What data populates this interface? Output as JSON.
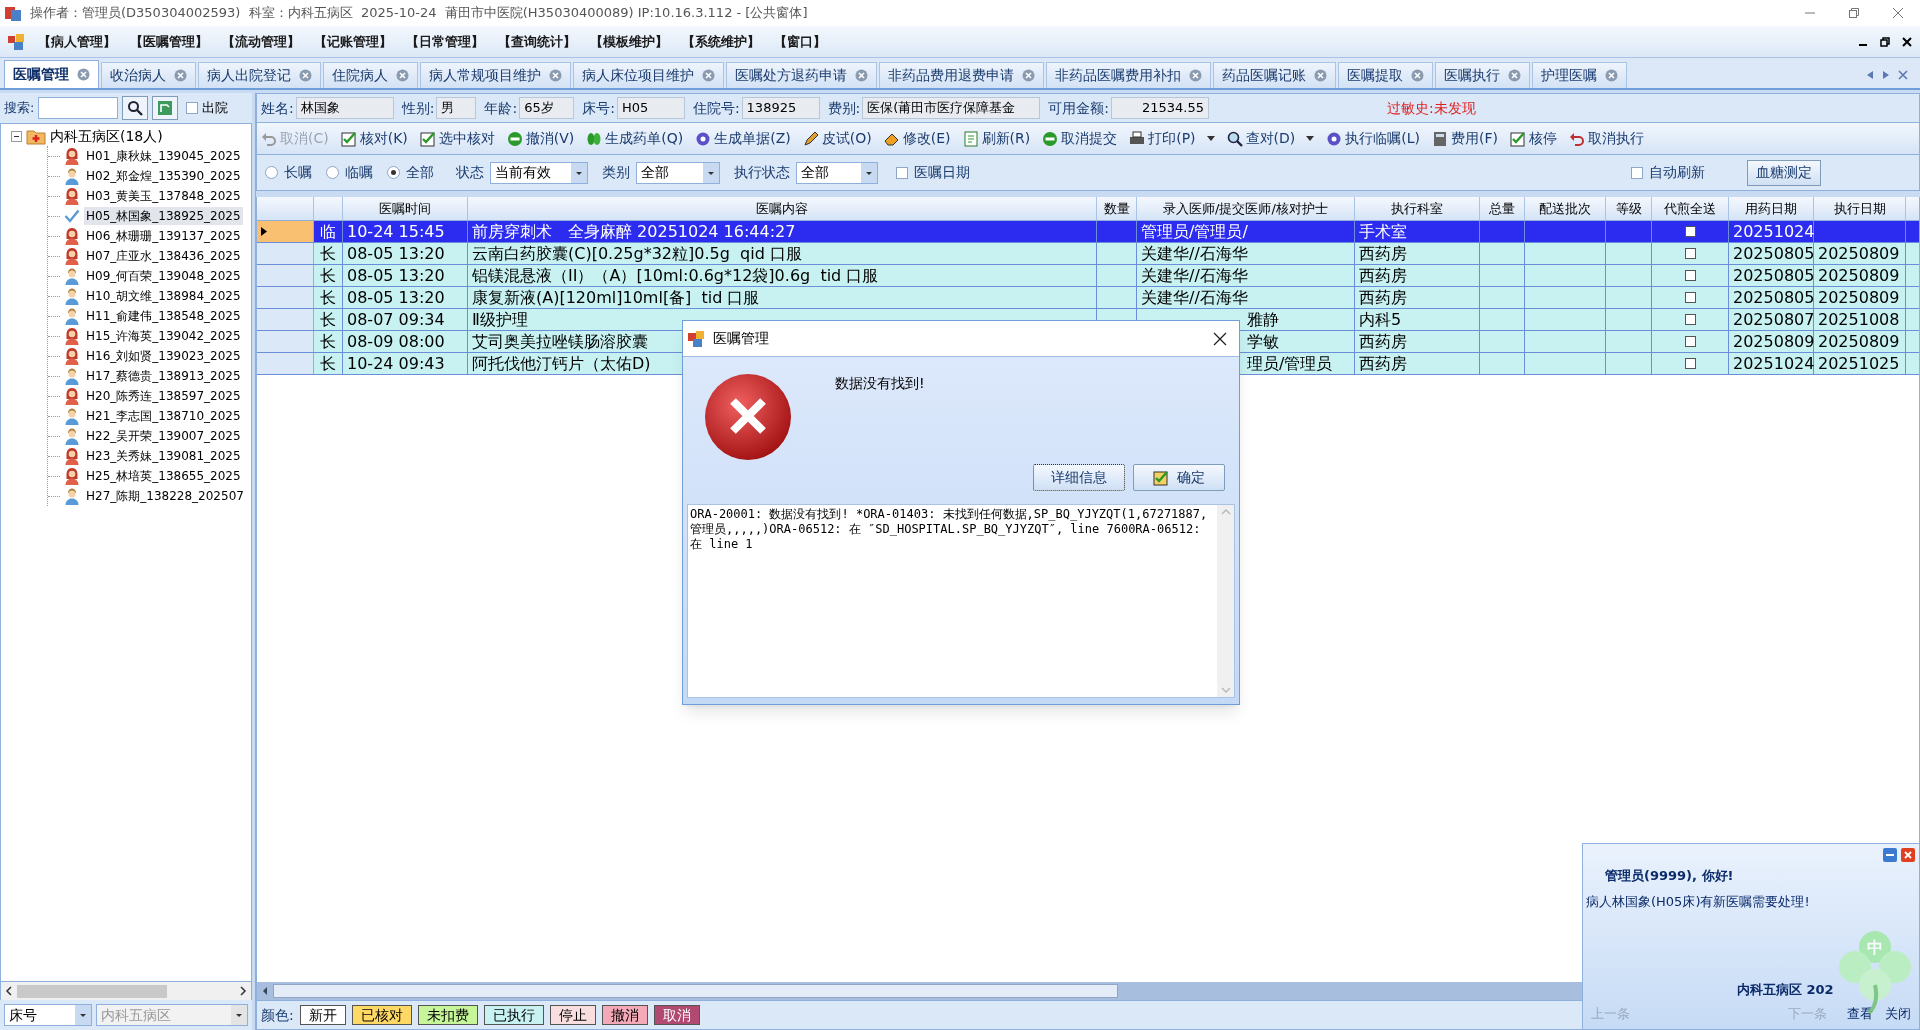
{
  "title_bar": {
    "title": "操作者：管理员(D350304002593)  科室：内科五病区  2025-10-24  莆田市中医院(H35030400089) IP:10.16.3.112 - [公共窗体]"
  },
  "menu": [
    "【病人管理】",
    "【医嘱管理】",
    "【流动管理】",
    "【记账管理】",
    "【日常管理】",
    "【查询统计】",
    "【模板维护】",
    "【系统维护】",
    "【窗口】"
  ],
  "tabs": [
    {
      "label": "医嘱管理",
      "selected": true
    },
    {
      "label": "收治病人",
      "selected": false
    },
    {
      "label": "病人出院登记",
      "selected": false
    },
    {
      "label": "住院病人",
      "selected": false
    },
    {
      "label": "病人常规项目维护",
      "selected": false
    },
    {
      "label": "病人床位项目维护",
      "selected": false
    },
    {
      "label": "医嘱处方退药申请",
      "selected": false
    },
    {
      "label": "非药品费用退费申请",
      "selected": false
    },
    {
      "label": "非药品医嘱费用补扣",
      "selected": false
    },
    {
      "label": "药品医嘱记账",
      "selected": false
    },
    {
      "label": "医嘱提取",
      "selected": false
    },
    {
      "label": "医嘱执行",
      "selected": false
    },
    {
      "label": "护理医嘱",
      "selected": false
    }
  ],
  "search": {
    "label": "搜索:",
    "discharged": {
      "label": "出院",
      "checked": false
    }
  },
  "tree": {
    "label": "内科五病区(18人)",
    "expanded": true,
    "children": [
      {
        "label": "H01_康秋妹_139045_2025",
        "kind": "female",
        "selected": false
      },
      {
        "label": "H02_郑金煌_135390_2025",
        "kind": "male",
        "selected": false
      },
      {
        "label": "H03_黄美玉_137848_2025",
        "kind": "female",
        "selected": false
      },
      {
        "label": "H05_林国象_138925_2025",
        "kind": "current",
        "selected": true
      },
      {
        "label": "H06_林珊珊_139137_2025",
        "kind": "female",
        "selected": false
      },
      {
        "label": "H07_庄亚水_138436_2025",
        "kind": "female",
        "selected": false
      },
      {
        "label": "H09_何百荣_139048_2025",
        "kind": "male",
        "selected": false
      },
      {
        "label": "H10_胡文维_138984_2025",
        "kind": "male",
        "selected": false
      },
      {
        "label": "H11_俞建伟_138548_2025",
        "kind": "male",
        "selected": false
      },
      {
        "label": "H15_许海英_139042_2025",
        "kind": "female",
        "selected": false
      },
      {
        "label": "H16_刘如贤_139023_2025",
        "kind": "female",
        "selected": false
      },
      {
        "label": "H17_蔡德贵_138913_2025",
        "kind": "male",
        "selected": false
      },
      {
        "label": "H20_陈秀连_138597_2025",
        "kind": "female",
        "selected": false
      },
      {
        "label": "H21_李志国_138710_2025",
        "kind": "male",
        "selected": false
      },
      {
        "label": "H22_吴开荣_139007_2025",
        "kind": "male",
        "selected": false
      },
      {
        "label": "H23_关秀妹_139081_2025",
        "kind": "female",
        "selected": false
      },
      {
        "label": "H25_林培英_138655_2025",
        "kind": "female",
        "selected": false
      },
      {
        "label": "H27_陈期_138228_202507",
        "kind": "male",
        "selected": false
      }
    ]
  },
  "bed_select": {
    "value": "床号"
  },
  "ward_select": {
    "value": "内科五病区",
    "disabled": true
  },
  "patient_info": [
    {
      "label": "姓名:",
      "value": "林国象"
    },
    {
      "label": "性别:",
      "value": "男"
    },
    {
      "label": "年龄:",
      "value": "65岁"
    },
    {
      "label": "床号:",
      "value": "H05"
    },
    {
      "label": "住院号:",
      "value": "138925"
    },
    {
      "label": "费别:",
      "value": "医保(莆田市医疗保障基金"
    },
    {
      "label": "可用金额:",
      "value": "21534.55"
    }
  ],
  "allergy": "过敏史:未发现",
  "toolbar": [
    {
      "label": "取消(C)",
      "disabled": true,
      "dropdown": false
    },
    {
      "label": "核对(K)",
      "disabled": false,
      "dropdown": false
    },
    {
      "label": "选中核对",
      "disabled": false,
      "dropdown": false
    },
    {
      "label": "撤消(V)",
      "disabled": false,
      "dropdown": false
    },
    {
      "label": "生成药单(Q)",
      "disabled": false,
      "dropdown": false
    },
    {
      "label": "生成单据(Z)",
      "disabled": false,
      "dropdown": false
    },
    {
      "label": "皮试(O)",
      "disabled": false,
      "dropdown": false
    },
    {
      "label": "修改(E)",
      "disabled": false,
      "dropdown": false
    },
    {
      "label": "刷新(R)",
      "disabled": false,
      "dropdown": false
    },
    {
      "label": "取消提交",
      "disabled": false,
      "dropdown": false
    },
    {
      "label": "打印(P)",
      "disabled": false,
      "dropdown": true
    },
    {
      "label": "查对(D)",
      "disabled": false,
      "dropdown": true
    },
    {
      "label": "执行临嘱(L)",
      "disabled": false,
      "dropdown": false
    },
    {
      "label": "费用(F)",
      "disabled": false,
      "dropdown": false
    },
    {
      "label": "核停",
      "disabled": false,
      "dropdown": false
    },
    {
      "label": "取消执行",
      "disabled": false,
      "dropdown": false
    }
  ],
  "filters": {
    "order_types": [
      {
        "label": "长嘱",
        "selected": false
      },
      {
        "label": "临嘱",
        "selected": false
      },
      {
        "label": "全部",
        "selected": true
      }
    ],
    "selects": [
      {
        "label": "状态",
        "value": "当前有效"
      },
      {
        "label": "类别",
        "value": "全部"
      },
      {
        "label": "执行状态",
        "value": "全部"
      }
    ],
    "order_date": {
      "label": "医嘱日期",
      "checked": false
    },
    "auto_refresh": {
      "label": "自动刷新",
      "checked": false
    },
    "glucose_button": "血糖测定"
  },
  "table": {
    "columns": [
      "医嘱时间",
      "医嘱内容",
      "数量",
      "录入医师/提交医师/核对护士",
      "执行科室",
      "总量",
      "配送批次",
      "等级",
      "代煎全送",
      "用药日期",
      "执行日期"
    ],
    "rows": [
      {
        "selected": true,
        "order_type": "临",
        "time": "10-24 15:45",
        "content": "前房穿刺术　全身麻醉 20251024 16:44:27",
        "doctor": "管理员/管理员/",
        "dept": "手术室",
        "full_send": false,
        "med_date": "20251024"
      },
      {
        "selected": false,
        "order_type": "长",
        "time": "08-05 13:20",
        "content": "云南白药胶囊(C)[0.25g*32粒]0.5g  qid 口服",
        "doctor": "关建华//石海华",
        "dept": "西药房",
        "full_send": false,
        "med_date": "20250805",
        "exec_date": "20250809"
      },
      {
        "selected": false,
        "order_type": "长",
        "time": "08-05 13:20",
        "content": "铝镁混悬液（II）（A）[10ml:0.6g*12袋]0.6g  tid 口服",
        "doctor": "关建华//石海华",
        "dept": "西药房",
        "full_send": false,
        "med_date": "20250805",
        "exec_date": "20250809"
      },
      {
        "selected": false,
        "order_type": "长",
        "time": "08-05 13:20",
        "content": "康复新液(A)[120ml]10ml[备]  tid 口服",
        "doctor": "关建华//石海华",
        "dept": "西药房",
        "full_send": false,
        "med_date": "20250805",
        "exec_date": "20250809"
      },
      {
        "selected": false,
        "order_type": "长",
        "time": "08-07 09:34",
        "content": "Ⅱ级护理",
        "doctor": "雅静",
        "dept": "内科5",
        "full_send": false,
        "med_date": "20250807",
        "exec_date": "20251008"
      },
      {
        "selected": false,
        "order_type": "长",
        "time": "08-09 08:00",
        "content": "艾司奥美拉唑镁肠溶胶囊",
        "doctor": "学敏",
        "dept": "西药房",
        "full_send": false,
        "med_date": "20250809",
        "exec_date": "20250809"
      },
      {
        "selected": false,
        "order_type": "长",
        "time": "10-24 09:43",
        "content": "阿托伐他汀钙片（太佑D)",
        "doctor": "理员/管理员",
        "dept": "西药房",
        "full_send": false,
        "med_date": "20251024",
        "exec_date": "20251025"
      }
    ]
  },
  "legend": {
    "label": "颜色:",
    "items": [
      {
        "label": "新开",
        "color": "#ffffff"
      },
      {
        "label": "已核对",
        "color": "#ffd966"
      },
      {
        "label": "未扣费",
        "color": "#c6f59a"
      },
      {
        "label": "已执行",
        "color": "#c8f2f2"
      },
      {
        "label": "停止",
        "color": "#f8dede"
      },
      {
        "label": "撤消",
        "color": "#f4a9b8"
      },
      {
        "label": "取消",
        "color": "#b04a70"
      }
    ]
  },
  "dialog": {
    "title": "医嘱管理",
    "message": "数据没有找到!",
    "buttons": [
      {
        "label": "详细信息",
        "kind": "details"
      },
      {
        "label": "确定",
        "kind": "ok"
      }
    ],
    "details": "ORA-20001: 数据没有找到! *ORA-01403: 未找到任何数据,SP_BQ_YJYZQT(1,67271887,管理员,,,,,)ORA-06512: 在 ″SD_HOSPITAL.SP_BQ_YJYZQT″, line 7600RA-06512: 在 line 1"
  },
  "notification": {
    "greeting": "管理员(9999), 你好!",
    "message": "病人林国象(H05床)有新医嘱需要处理!",
    "footer": "内科五病区 202",
    "logo_text": "中",
    "links": [
      {
        "label": "上一条",
        "disabled": true
      },
      {
        "label": "下一条",
        "disabled": true
      },
      {
        "label": "查看",
        "disabled": false
      },
      {
        "label": "关闭",
        "disabled": false
      }
    ]
  }
}
